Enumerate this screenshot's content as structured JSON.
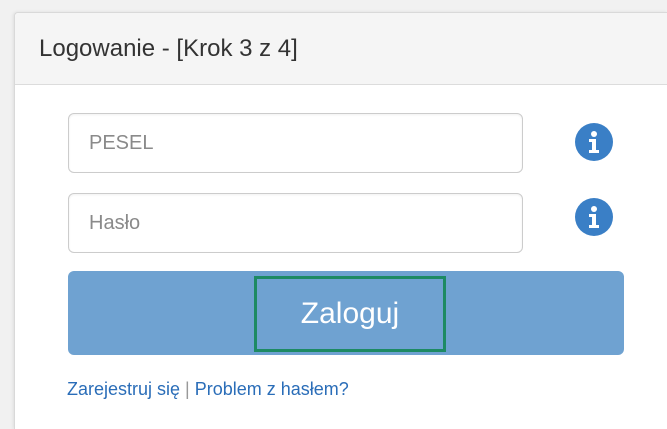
{
  "header": {
    "title": "Logowanie - [Krok 3 z 4]"
  },
  "form": {
    "pesel": {
      "value": "",
      "placeholder": "PESEL"
    },
    "haslo": {
      "value": "",
      "placeholder": "Hasło"
    },
    "info_icon": "info-circle-icon",
    "submit_label": "Zaloguj"
  },
  "links": {
    "register_label": "Zarejestruj się",
    "separator": "|",
    "password_problem_label": "Problem z hasłem?"
  },
  "colors": {
    "header_bg": "#f5f5f5",
    "button_bg": "#6fa2d1",
    "button_highlight_border": "#1d8a63",
    "info_icon": "#3a7fc6",
    "link": "#2a6db8"
  }
}
